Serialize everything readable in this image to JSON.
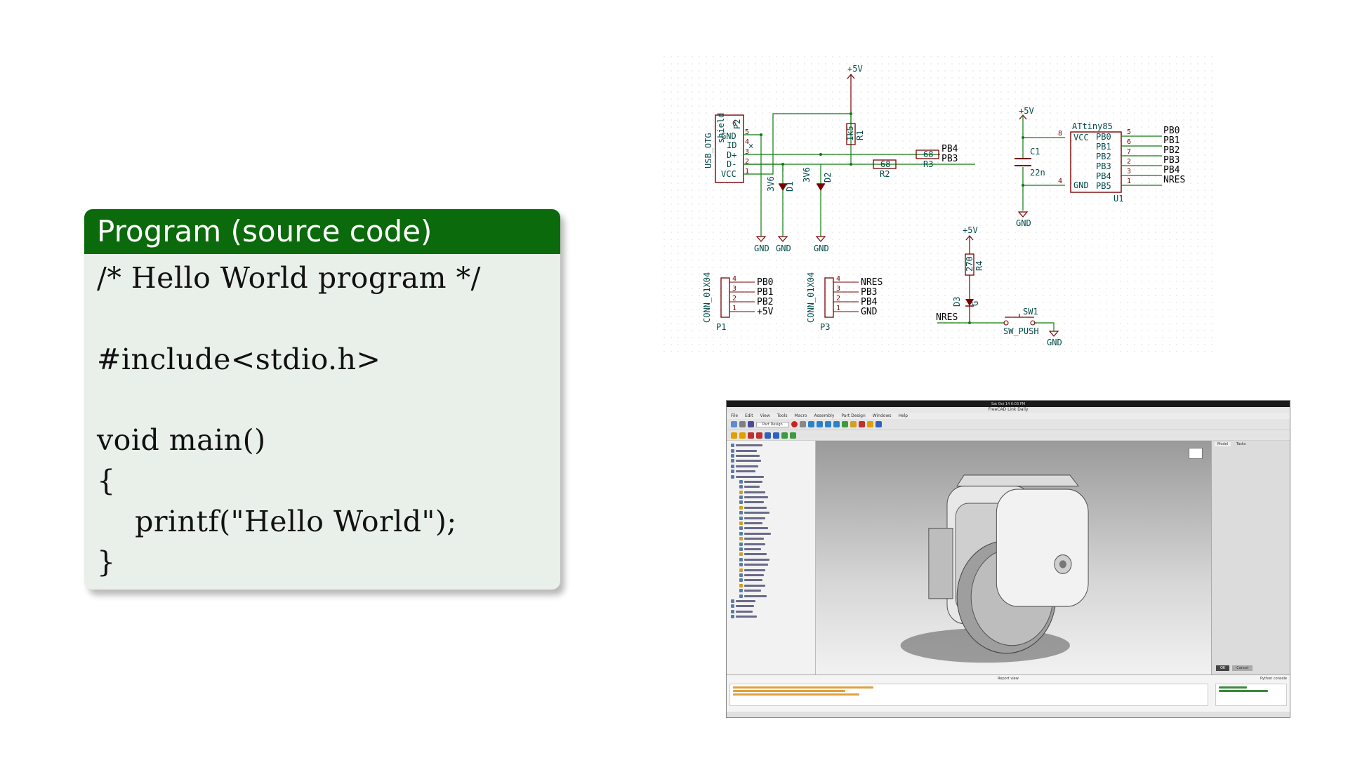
{
  "block": {
    "title": "Program (source code)",
    "code_lines": [
      "/* Hello World program */",
      "",
      "#include<stdio.h>",
      "",
      "void main()",
      "{",
      "    printf(\"Hello World\");",
      "}"
    ]
  },
  "schematic": {
    "power_labels": [
      "+5V",
      "+5V",
      "+5V"
    ],
    "gnd_label": "GND",
    "connector_usb": {
      "ref": "P2",
      "name": "USB_OTG",
      "shield": "shield",
      "pins": [
        "GND",
        "ID",
        "D+",
        "D-",
        "VCC"
      ],
      "pin_numbers": [
        "5",
        "4",
        "3",
        "2",
        "1"
      ],
      "pin6": "6"
    },
    "r1": {
      "ref": "R1",
      "value": "1k5"
    },
    "r2": {
      "ref": "R2",
      "value": "68"
    },
    "r3": {
      "ref": "R3",
      "value": "68"
    },
    "r4": {
      "ref": "R4",
      "value": "270"
    },
    "d1": {
      "ref": "D1",
      "value": "3V6"
    },
    "d2": {
      "ref": "D2",
      "value": "3V6"
    },
    "d3": {
      "ref": "D3",
      "value": "G"
    },
    "c1": {
      "ref": "C1",
      "value": "22n"
    },
    "u1": {
      "ref": "U1",
      "name": "ATtiny85",
      "left_pins": [
        "VCC",
        "GND"
      ],
      "left_numbers": [
        "8",
        "4"
      ],
      "right_pins": [
        "PB0",
        "PB1",
        "PB2",
        "PB3",
        "PB4",
        "PB5"
      ],
      "right_numbers": [
        "5",
        "6",
        "7",
        "2",
        "3",
        "1"
      ],
      "right_nets": [
        "PB0",
        "PB1",
        "PB2",
        "PB3",
        "PB4",
        "NRES"
      ]
    },
    "usb_nets": [
      "PB4",
      "PB3"
    ],
    "p1": {
      "ref": "P1",
      "name": "CONN_01X04",
      "nets": [
        "PB0",
        "PB1",
        "PB2",
        "+5V"
      ],
      "numbers": [
        "4",
        "3",
        "2",
        "1"
      ]
    },
    "p3": {
      "ref": "P3",
      "name": "CONN_01X04",
      "nets": [
        "NRES",
        "PB3",
        "PB4",
        "GND"
      ],
      "numbers": [
        "4",
        "3",
        "2",
        "1"
      ]
    },
    "sw1": {
      "ref": "SW1",
      "name": "SW_PUSH",
      "net": "NRES"
    },
    "nc_mark": "×"
  },
  "freecad": {
    "title": "FreeCAD Link Daily",
    "menus": [
      "File",
      "Edit",
      "View",
      "Tools",
      "Macro",
      "Assembly",
      "Part Design",
      "Windows",
      "Help"
    ],
    "workbench": "Part Design",
    "clock": "Sat Oct 14  6:03 PM",
    "panel_tabs": [
      "Model",
      "Tasks"
    ],
    "report_title": "Report view",
    "python_title": "Python console",
    "ok_label": "OK",
    "cancel_label": "Cancel"
  }
}
